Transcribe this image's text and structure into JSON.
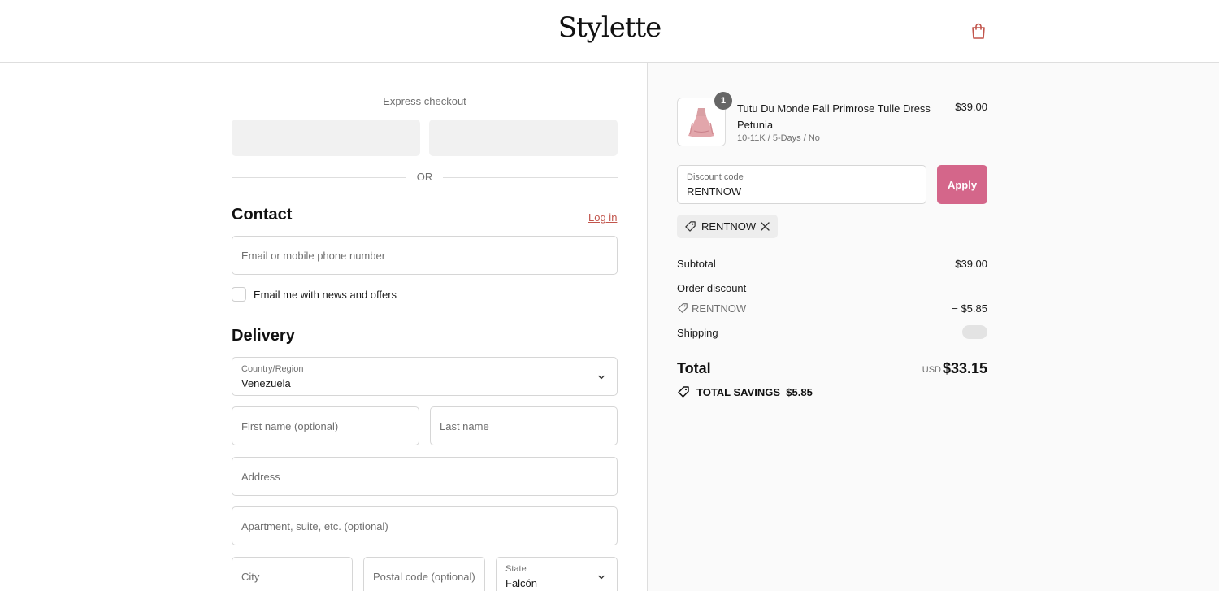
{
  "header": {
    "logo": "Stylette",
    "cart_icon": "shopping-bag-icon",
    "accent": "#c2554c"
  },
  "express": {
    "title": "Express checkout",
    "separator": "OR"
  },
  "contact": {
    "title": "Contact",
    "login_label": "Log in",
    "email_placeholder": "Email or mobile phone number",
    "newsletter_label": "Email me with news and offers"
  },
  "delivery": {
    "title": "Delivery",
    "country_label": "Country/Region",
    "country_value": "Venezuela",
    "first_name_placeholder": "First name (optional)",
    "last_name_placeholder": "Last name",
    "address_placeholder": "Address",
    "apartment_placeholder": "Apartment, suite, etc. (optional)",
    "city_placeholder": "City",
    "postal_placeholder": "Postal code (optional)",
    "state_label": "State",
    "state_value": "Falcón"
  },
  "order": {
    "item": {
      "quantity": "1",
      "name": "Tutu Du Monde Fall Primrose Tulle Dress Petunia",
      "variant": "10-11K / 5-Days / No",
      "price": "$39.00"
    },
    "discount": {
      "label": "Discount code",
      "value": "RENTNOW",
      "apply_label": "Apply",
      "apply_color": "#d4668a",
      "applied_code": "RENTNOW"
    },
    "summary": {
      "subtotal_label": "Subtotal",
      "subtotal_value": "$39.00",
      "order_discount_label": "Order discount",
      "discount_code": "RENTNOW",
      "discount_value": "− $5.85",
      "shipping_label": "Shipping",
      "total_label": "Total",
      "currency": "USD",
      "total_value": "$33.15",
      "savings_label": "TOTAL SAVINGS",
      "savings_value": "$5.85"
    }
  }
}
